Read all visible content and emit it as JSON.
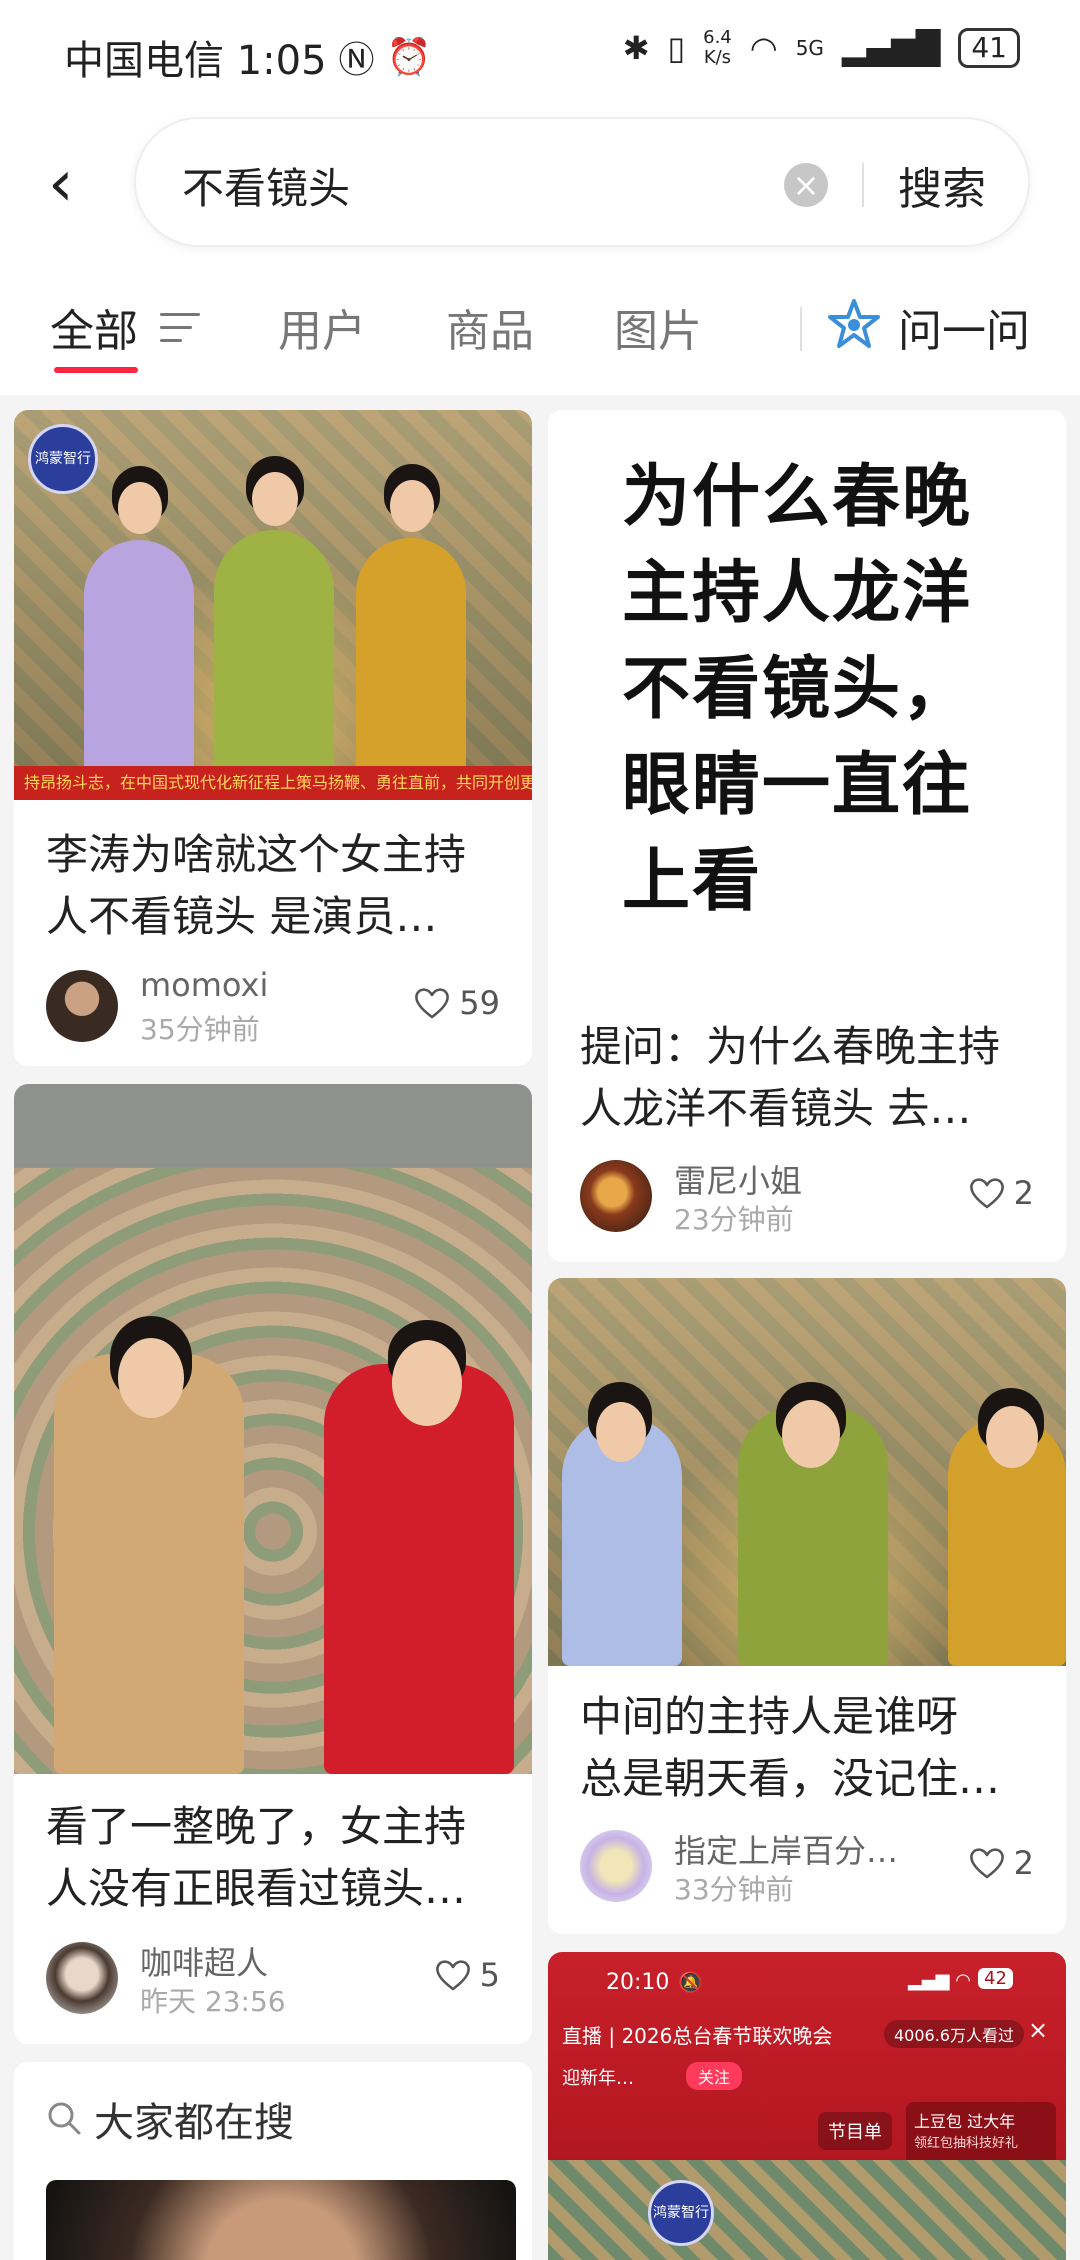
{
  "status_bar": {
    "carrier_time": "中国电信 1:05",
    "speed_value": "6.4",
    "speed_unit": "K/s",
    "network": "5G",
    "battery": "41"
  },
  "search": {
    "query": "不看镜头",
    "button_label": "搜索"
  },
  "tabs": [
    {
      "label": "全部"
    },
    {
      "label": "用户"
    },
    {
      "label": "商品"
    },
    {
      "label": "图片"
    }
  ],
  "ask_label": "问一问",
  "posts": [
    {
      "title_line1": "李涛为啥就这个女主持",
      "title_line2": "人不看镜头 是演员…",
      "author": "momoxi",
      "time": "35分钟前",
      "likes": "59",
      "image_badge": "鸿蒙智行",
      "image_banner": "持昂扬斗志，在中国式现代化新征程上策马扬鞭、勇往直前，共同开创更加美好的未"
    },
    {
      "cover_text_lines": [
        "为什么春晚",
        "主持人龙洋",
        "不看镜头，",
        "眼睛一直往",
        "上看"
      ],
      "title_line1": "提问：为什么春晚主持",
      "title_line2": "人龙洋不看镜头 去…",
      "author": "雷尼小姐",
      "time": "23分钟前",
      "likes": "2"
    },
    {
      "title_line1": "看了一整晚了，女主持",
      "title_line2": "人没有正眼看过镜头…",
      "author": "咖啡超人",
      "time": "昨天 23:56",
      "likes": "5"
    },
    {
      "title_line1": "中间的主持人是谁呀",
      "title_line2": "总是朝天看，没记住…",
      "author": "指定上岸百分…",
      "time": "33分钟前",
      "likes": "2"
    }
  ],
  "suggest_section": {
    "title": "大家都在搜"
  },
  "live_card": {
    "time": "20:10",
    "battery": "42",
    "title": "直播 | 2026总台春节联欢晚会",
    "viewers": "4006.6万人看过",
    "follow": "关注",
    "channel": "迎新年…",
    "program_list": "节目单",
    "promo_line1": "上豆包 过大年",
    "promo_line2": "领红包抽科技好礼",
    "badge": "鸿蒙智行"
  },
  "colors": {
    "accent": "#ff2442",
    "background": "#f4f4f4"
  }
}
